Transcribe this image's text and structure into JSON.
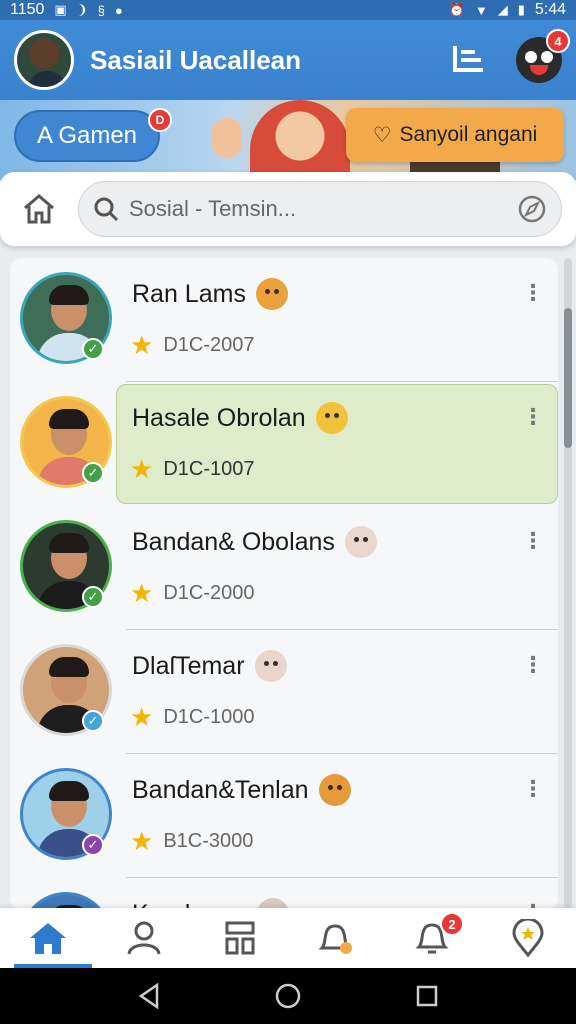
{
  "status_bar": {
    "time_left": "1150",
    "time_right": "5:44"
  },
  "app_bar": {
    "title": "Sasiail Uacallean",
    "notification_count": "4"
  },
  "banner": {
    "left_button": "A Gamen",
    "left_badge": "D",
    "right_button": "Sanyoil angani"
  },
  "search": {
    "placeholder": "Sosial - Temsin..."
  },
  "contacts": [
    {
      "name": "Ran Lams",
      "meta": "D1C-2007",
      "emoji_color": "#e9a23b",
      "body_color": "#cfe3f1",
      "bg": "#3e6e58",
      "ring": "#3aa6b9",
      "check_color": "#43a047",
      "check": "✓"
    },
    {
      "name": "Hasale Obrolan",
      "meta": "D1C-1007",
      "emoji_color": "#f2c23a",
      "body_color": "#e07a6a",
      "bg": "#f3b44a",
      "ring": "#f2c94c",
      "check_color": "#43a047",
      "check": "✓",
      "highlight": true
    },
    {
      "name": "Bandan& Obolans",
      "meta": "D1C-2000",
      "emoji_color": "#e9d6cf",
      "body_color": "#1c1c1c",
      "bg": "#2c3b2e",
      "ring": "#4caf50",
      "check_color": "#43a047",
      "check": "✓"
    },
    {
      "name": "DlaſTemar",
      "meta": "D1C-1000",
      "emoji_color": "#ead5cc",
      "body_color": "#1e1e1e",
      "bg": "#cfa377",
      "ring": "#d9d9d9",
      "check_color": "#42a5d8",
      "check": "✓"
    },
    {
      "name": "Bandan&Tenlan",
      "meta": "B1C-3000",
      "emoji_color": "#e49a3a",
      "body_color": "#3a4f8a",
      "bg": "#9fd0ea",
      "ring": "#3f86c8",
      "check_color": "#8e44ad",
      "check": "✓"
    },
    {
      "name": "Kandamar",
      "meta": "",
      "emoji_color": "#d8c9c2",
      "body_color": "#333333",
      "bg": "#3f78b8",
      "ring": "#3f86c8",
      "check_color": "#43a047",
      "check": ""
    }
  ],
  "bottom_nav": {
    "alerts_badge": "2"
  },
  "colors": {
    "primary": "#3f86d3",
    "accent": "#f3a94a",
    "highlight": "#dfeccb",
    "badge": "#e53935"
  }
}
